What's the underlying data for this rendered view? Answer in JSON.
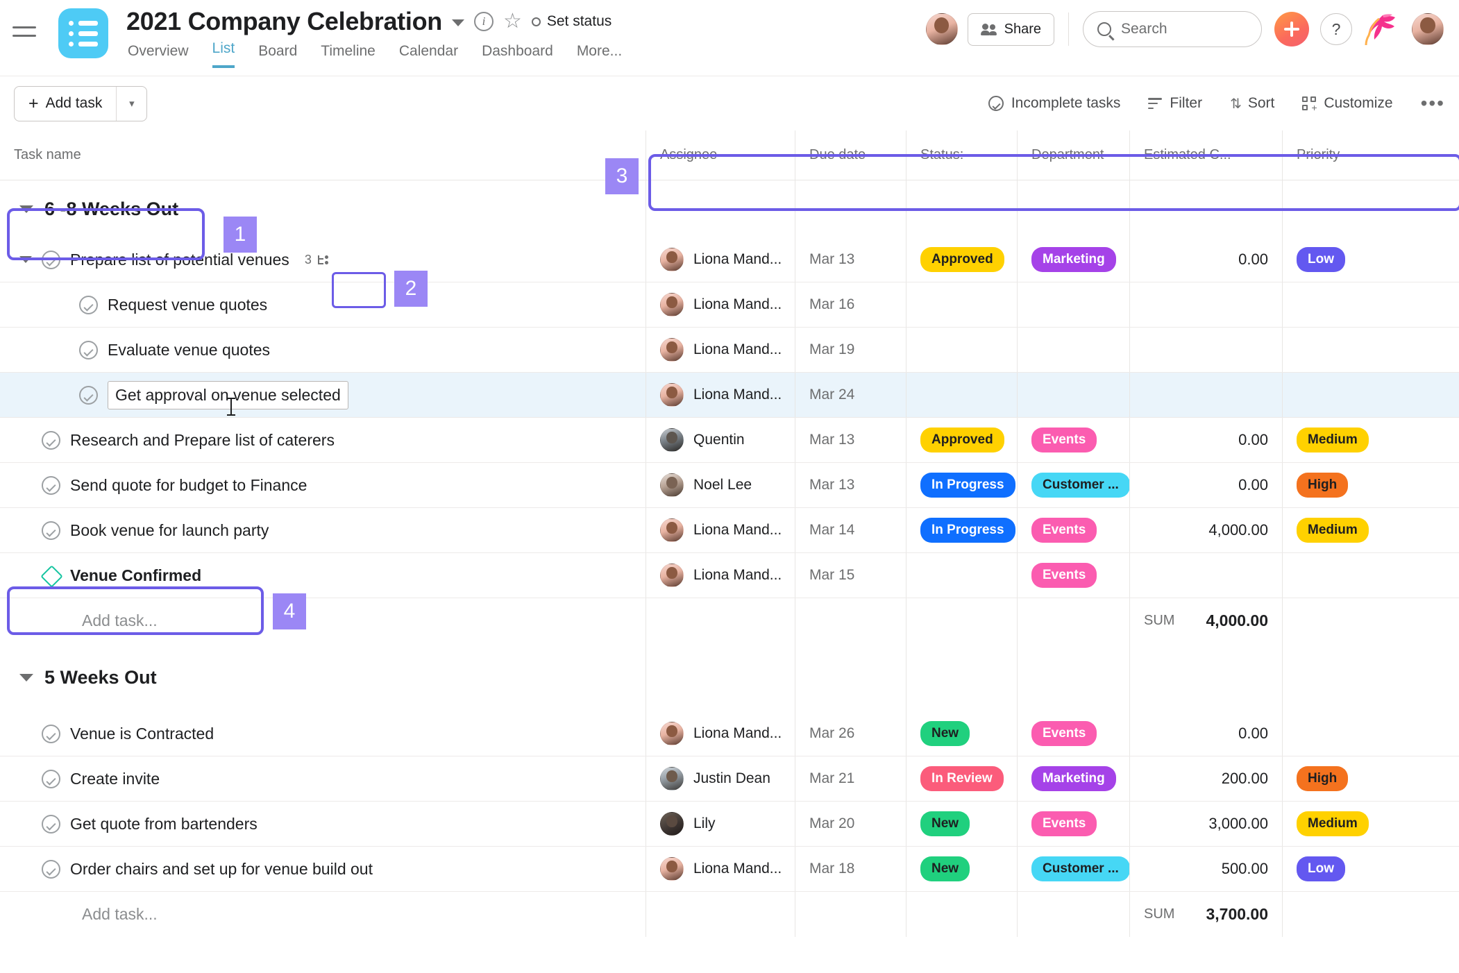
{
  "header": {
    "project_title": "2021 Company Celebration",
    "set_status": "Set status",
    "tabs": [
      {
        "label": "Overview",
        "active": false
      },
      {
        "label": "List",
        "active": true
      },
      {
        "label": "Board",
        "active": false
      },
      {
        "label": "Timeline",
        "active": false
      },
      {
        "label": "Calendar",
        "active": false
      },
      {
        "label": "Dashboard",
        "active": false
      },
      {
        "label": "More...",
        "active": false
      }
    ],
    "share_label": "Share",
    "search_placeholder": "Search",
    "help_label": "?"
  },
  "toolbar": {
    "add_task_label": "Add task",
    "add_task_plus": "+",
    "incomplete_tasks": "Incomplete tasks",
    "filter": "Filter",
    "sort": "Sort",
    "customize": "Customize",
    "more": "•••"
  },
  "columns": {
    "task_name": "Task name",
    "assignee": "Assignee",
    "due_date": "Due date",
    "status": "Status:",
    "department": "Department",
    "estimated_cost": "Estimated C...",
    "priority": "Priority"
  },
  "sections": [
    {
      "title": "6 -8 Weeks Out",
      "add_task": "Add task...",
      "sum_label": "SUM",
      "sum_value": "4,000.00",
      "rows": [
        {
          "name": "Prepare list of potential venues",
          "type": "task",
          "level": 0,
          "expandable": true,
          "subtask_count": "3",
          "assignee": "Liona Mand...",
          "due": "Mar 13",
          "status": "Approved",
          "department": "Marketing",
          "cost": "0.00",
          "priority": "Low"
        },
        {
          "name": "Request venue quotes",
          "type": "task",
          "level": 1,
          "assignee": "Liona Mand...",
          "due": "Mar 16",
          "status": "",
          "department": "",
          "cost": "",
          "priority": ""
        },
        {
          "name": "Evaluate venue quotes",
          "type": "task",
          "level": 1,
          "assignee": "Liona Mand...",
          "due": "Mar 19",
          "status": "",
          "department": "",
          "cost": "",
          "priority": ""
        },
        {
          "name": "Get approval on venue selected",
          "type": "task",
          "level": 1,
          "editing": true,
          "selected": true,
          "assignee": "Liona Mand...",
          "due": "Mar 24",
          "status": "",
          "department": "",
          "cost": "",
          "priority": ""
        },
        {
          "name": "Research and Prepare list of caterers",
          "type": "task",
          "level": 0,
          "assignee": "Quentin",
          "due": "Mar 13",
          "status": "Approved",
          "department": "Events",
          "cost": "0.00",
          "priority": "Medium"
        },
        {
          "name": "Send quote for budget to Finance",
          "type": "task",
          "level": 0,
          "assignee": "Noel Lee",
          "due": "Mar 13",
          "status": "In Progress",
          "department": "Customer ...",
          "cost": "0.00",
          "priority": "High"
        },
        {
          "name": "Book venue for launch party",
          "type": "task",
          "level": 0,
          "assignee": "Liona Mand...",
          "due": "Mar 14",
          "status": "In Progress",
          "department": "Events",
          "cost": "4,000.00",
          "priority": "Medium"
        },
        {
          "name": "Venue Confirmed",
          "type": "milestone",
          "level": 0,
          "assignee": "Liona Mand...",
          "due": "Mar 15",
          "status": "",
          "department": "Events",
          "cost": "",
          "priority": ""
        }
      ]
    },
    {
      "title": "5 Weeks Out",
      "add_task": "Add task...",
      "sum_label": "SUM",
      "sum_value": "3,700.00",
      "rows": [
        {
          "name": "Venue is Contracted",
          "type": "task",
          "level": 0,
          "assignee": "Liona Mand...",
          "due": "Mar 26",
          "status": "New",
          "department": "Events",
          "cost": "0.00",
          "priority": ""
        },
        {
          "name": "Create invite",
          "type": "task",
          "level": 0,
          "assignee": "Justin Dean",
          "due": "Mar 21",
          "status": "In Review",
          "department": "Marketing",
          "cost": "200.00",
          "priority": "High"
        },
        {
          "name": "Get quote from bartenders",
          "type": "task",
          "level": 0,
          "assignee": "Lily",
          "due": "Mar 20",
          "status": "New",
          "department": "Events",
          "cost": "3,000.00",
          "priority": "Medium"
        },
        {
          "name": "Order chairs and set up for venue build out",
          "type": "task",
          "level": 0,
          "assignee": "Liona Mand...",
          "due": "Mar 18",
          "status": "New",
          "department": "Customer ...",
          "cost": "500.00",
          "priority": "Low"
        }
      ]
    }
  ],
  "annotations": [
    {
      "number": "1",
      "target": "section-header-6-8-weeks-out"
    },
    {
      "number": "2",
      "target": "subtask-count-badge"
    },
    {
      "number": "3",
      "target": "custom-fields-column-headers"
    },
    {
      "number": "4",
      "target": "milestone-row-venue-confirmed"
    }
  ],
  "colors": {
    "accent_tab": "#4ea6c9",
    "annotation_border": "#6c5ce7",
    "annotation_badge": "#9b87f5",
    "status_approved_bg": "#ffd100",
    "status_approved_fg": "#1e1f21",
    "status_in_progress_bg": "#0f6fff",
    "status_in_progress_fg": "#ffffff",
    "status_new_bg": "#20d07e",
    "status_new_fg": "#1e1f21",
    "status_in_review_bg": "#fb5c7b",
    "status_in_review_fg": "#ffffff",
    "dept_marketing_bg": "#a542e8",
    "dept_marketing_fg": "#ffffff",
    "dept_events_bg": "#fb5cb0",
    "dept_events_fg": "#ffffff",
    "dept_customer_bg": "#46d7f5",
    "dept_customer_fg": "#1e1f21",
    "pri_low_bg": "#6358f0",
    "pri_low_fg": "#ffffff",
    "pri_medium_bg": "#ffd100",
    "pri_medium_fg": "#1e1f21",
    "pri_high_bg": "#f4721e",
    "pri_high_fg": "#1e1f21",
    "milestone": "#14c4a0",
    "selected_row": "#eaf4fb"
  }
}
